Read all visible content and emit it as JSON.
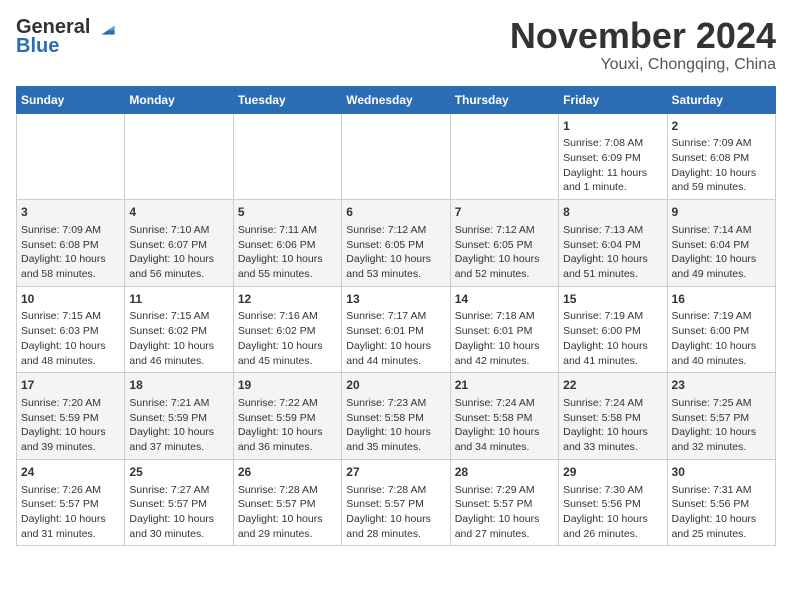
{
  "header": {
    "logo_line1": "General",
    "logo_line2": "Blue",
    "month": "November 2024",
    "location": "Youxi, Chongqing, China"
  },
  "days_of_week": [
    "Sunday",
    "Monday",
    "Tuesday",
    "Wednesday",
    "Thursday",
    "Friday",
    "Saturday"
  ],
  "weeks": [
    [
      {
        "day": "",
        "info": ""
      },
      {
        "day": "",
        "info": ""
      },
      {
        "day": "",
        "info": ""
      },
      {
        "day": "",
        "info": ""
      },
      {
        "day": "",
        "info": ""
      },
      {
        "day": "1",
        "info": "Sunrise: 7:08 AM\nSunset: 6:09 PM\nDaylight: 11 hours and 1 minute."
      },
      {
        "day": "2",
        "info": "Sunrise: 7:09 AM\nSunset: 6:08 PM\nDaylight: 10 hours and 59 minutes."
      }
    ],
    [
      {
        "day": "3",
        "info": "Sunrise: 7:09 AM\nSunset: 6:08 PM\nDaylight: 10 hours and 58 minutes."
      },
      {
        "day": "4",
        "info": "Sunrise: 7:10 AM\nSunset: 6:07 PM\nDaylight: 10 hours and 56 minutes."
      },
      {
        "day": "5",
        "info": "Sunrise: 7:11 AM\nSunset: 6:06 PM\nDaylight: 10 hours and 55 minutes."
      },
      {
        "day": "6",
        "info": "Sunrise: 7:12 AM\nSunset: 6:05 PM\nDaylight: 10 hours and 53 minutes."
      },
      {
        "day": "7",
        "info": "Sunrise: 7:12 AM\nSunset: 6:05 PM\nDaylight: 10 hours and 52 minutes."
      },
      {
        "day": "8",
        "info": "Sunrise: 7:13 AM\nSunset: 6:04 PM\nDaylight: 10 hours and 51 minutes."
      },
      {
        "day": "9",
        "info": "Sunrise: 7:14 AM\nSunset: 6:04 PM\nDaylight: 10 hours and 49 minutes."
      }
    ],
    [
      {
        "day": "10",
        "info": "Sunrise: 7:15 AM\nSunset: 6:03 PM\nDaylight: 10 hours and 48 minutes."
      },
      {
        "day": "11",
        "info": "Sunrise: 7:15 AM\nSunset: 6:02 PM\nDaylight: 10 hours and 46 minutes."
      },
      {
        "day": "12",
        "info": "Sunrise: 7:16 AM\nSunset: 6:02 PM\nDaylight: 10 hours and 45 minutes."
      },
      {
        "day": "13",
        "info": "Sunrise: 7:17 AM\nSunset: 6:01 PM\nDaylight: 10 hours and 44 minutes."
      },
      {
        "day": "14",
        "info": "Sunrise: 7:18 AM\nSunset: 6:01 PM\nDaylight: 10 hours and 42 minutes."
      },
      {
        "day": "15",
        "info": "Sunrise: 7:19 AM\nSunset: 6:00 PM\nDaylight: 10 hours and 41 minutes."
      },
      {
        "day": "16",
        "info": "Sunrise: 7:19 AM\nSunset: 6:00 PM\nDaylight: 10 hours and 40 minutes."
      }
    ],
    [
      {
        "day": "17",
        "info": "Sunrise: 7:20 AM\nSunset: 5:59 PM\nDaylight: 10 hours and 39 minutes."
      },
      {
        "day": "18",
        "info": "Sunrise: 7:21 AM\nSunset: 5:59 PM\nDaylight: 10 hours and 37 minutes."
      },
      {
        "day": "19",
        "info": "Sunrise: 7:22 AM\nSunset: 5:59 PM\nDaylight: 10 hours and 36 minutes."
      },
      {
        "day": "20",
        "info": "Sunrise: 7:23 AM\nSunset: 5:58 PM\nDaylight: 10 hours and 35 minutes."
      },
      {
        "day": "21",
        "info": "Sunrise: 7:24 AM\nSunset: 5:58 PM\nDaylight: 10 hours and 34 minutes."
      },
      {
        "day": "22",
        "info": "Sunrise: 7:24 AM\nSunset: 5:58 PM\nDaylight: 10 hours and 33 minutes."
      },
      {
        "day": "23",
        "info": "Sunrise: 7:25 AM\nSunset: 5:57 PM\nDaylight: 10 hours and 32 minutes."
      }
    ],
    [
      {
        "day": "24",
        "info": "Sunrise: 7:26 AM\nSunset: 5:57 PM\nDaylight: 10 hours and 31 minutes."
      },
      {
        "day": "25",
        "info": "Sunrise: 7:27 AM\nSunset: 5:57 PM\nDaylight: 10 hours and 30 minutes."
      },
      {
        "day": "26",
        "info": "Sunrise: 7:28 AM\nSunset: 5:57 PM\nDaylight: 10 hours and 29 minutes."
      },
      {
        "day": "27",
        "info": "Sunrise: 7:28 AM\nSunset: 5:57 PM\nDaylight: 10 hours and 28 minutes."
      },
      {
        "day": "28",
        "info": "Sunrise: 7:29 AM\nSunset: 5:57 PM\nDaylight: 10 hours and 27 minutes."
      },
      {
        "day": "29",
        "info": "Sunrise: 7:30 AM\nSunset: 5:56 PM\nDaylight: 10 hours and 26 minutes."
      },
      {
        "day": "30",
        "info": "Sunrise: 7:31 AM\nSunset: 5:56 PM\nDaylight: 10 hours and 25 minutes."
      }
    ]
  ]
}
